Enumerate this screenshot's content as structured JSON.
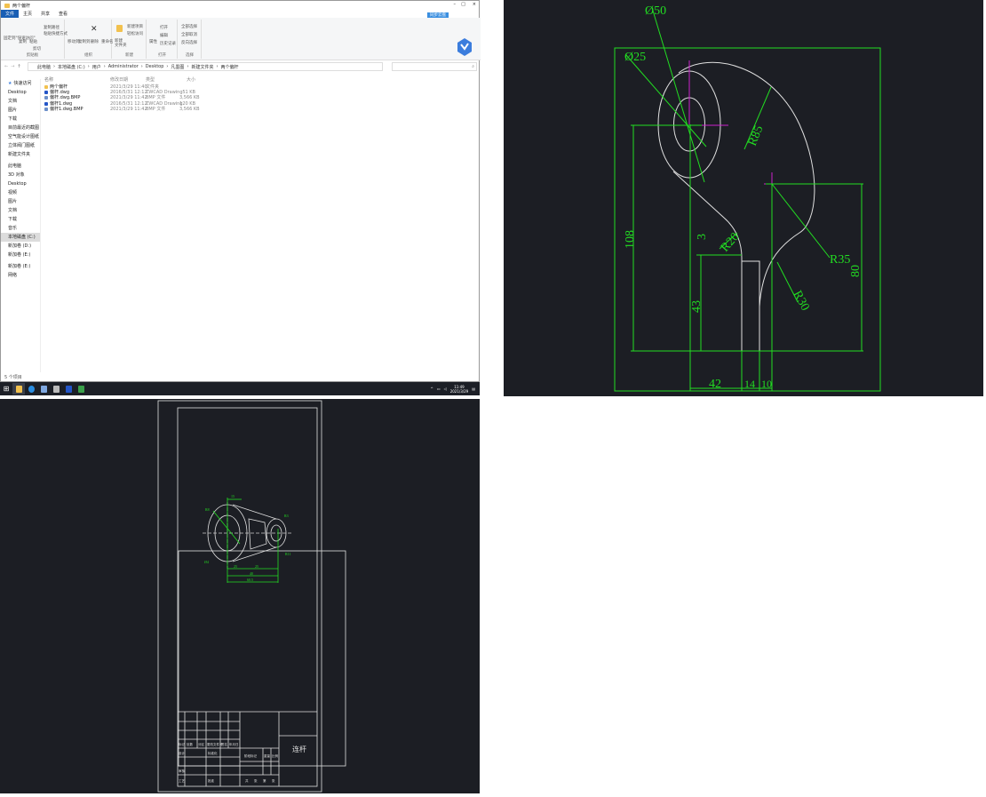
{
  "explorer": {
    "title": "两个偏杆",
    "window_controls": {
      "minimize": "–",
      "maximize": "□",
      "close": "×"
    },
    "menu_tabs": [
      "文件",
      "主页",
      "共享",
      "查看"
    ],
    "cloud_button": "同步云盘",
    "ribbon": {
      "groups": [
        "剪贴板",
        "组织",
        "新建",
        "打开",
        "选择"
      ],
      "pin": "固定到\"快速访问\"",
      "copy": "复制",
      "paste": "粘贴",
      "copy_path": "复制路径",
      "paste_shortcut": "粘贴快捷方式",
      "cut": "剪切",
      "move_to": "移动到",
      "copy_to": "复制到",
      "delete": "删除",
      "rename": "重命名",
      "new_folder": "新建\n文件夹",
      "new_item": "新建项目",
      "easy_access": "轻松访问",
      "properties": "属性",
      "open": "打开",
      "edit": "编辑",
      "history": "历史记录",
      "select_all": "全部选择",
      "select_none": "全部取消",
      "invert": "反向选择"
    },
    "breadcrumb": [
      "此电脑",
      "本地磁盘 (C:)",
      "用户",
      "Administrator",
      "Desktop",
      "凡墨图",
      "新建文件夹",
      "两个偏杆"
    ],
    "search_placeholder": "",
    "nav": {
      "quick_access": "快速访问",
      "quick_items": [
        "Desktop",
        "文档",
        "图片",
        "下载",
        "目前最近的截图",
        "空气能设计图纸",
        "立体阀门图纸",
        "新建文件夹"
      ],
      "this_pc": "此电脑",
      "pc_items": [
        "3D 对象",
        "Desktop",
        "视频",
        "图片",
        "文档",
        "下载",
        "音乐",
        "本地磁盘 (C:)",
        "新加卷 (D:)",
        "新加卷 (E:)"
      ],
      "extra": "新加卷 (E:)",
      "network": "网络"
    },
    "columns": [
      "名称",
      "修改日期",
      "类型",
      "大小"
    ],
    "files": [
      {
        "name": "两个偏杆",
        "date": "2021/3/29 11:40",
        "type": "文件夹",
        "size": "",
        "icon": "folder"
      },
      {
        "name": "偏杆.dwg",
        "date": "2016/5/31 12:12",
        "type": "ZWCAD Drawing",
        "size": "51 KB",
        "icon": "dwg"
      },
      {
        "name": "偏杆.dwg.BMP",
        "date": "2021/3/29 11:42",
        "type": "BMP 文件",
        "size": "3,566 KB",
        "icon": "bmp"
      },
      {
        "name": "偏杆1.dwg",
        "date": "2016/5/31 12:12",
        "type": "ZWCAD Drawing",
        "size": "120 KB",
        "icon": "dwg"
      },
      {
        "name": "偏杆1.dwg.BMP",
        "date": "2021/3/29 11:42",
        "type": "BMP 文件",
        "size": "3,566 KB",
        "icon": "bmp"
      }
    ],
    "status": "5 个项目"
  },
  "taskbar": {
    "time": "11:49",
    "date": "2021/3/29"
  },
  "cad_top": {
    "dims": {
      "d50": "Ø50",
      "d25": "Ø25",
      "r85": "R85",
      "r20": "R20",
      "r35": "R35",
      "r30": "R30",
      "h108": "108",
      "h80": "80",
      "h43": "43",
      "h3": "3",
      "w42": "42",
      "w14": "14",
      "w10": "10"
    },
    "colors": {
      "bg": "#1c1e24",
      "dim": "#22dd22",
      "geometry": "#e0e0e0",
      "center": "#cc22cc"
    }
  },
  "cad_bottom": {
    "dims": {
      "a": "R3",
      "b": "R8",
      "c": "Ø4",
      "d": "R11",
      "e": "25",
      "f": "25",
      "g": "40",
      "h": "60.5",
      "i": "15"
    },
    "title_block": {
      "part_name": "连杆",
      "row_headers": [
        "标记",
        "处数",
        "分区",
        "更改文件号",
        "签名",
        "年月日"
      ],
      "design": "设计",
      "standardize": "标准化",
      "review": "审核",
      "process": "工艺",
      "approve": "批准",
      "stage": "阶段标记",
      "weight": "重量",
      "scale": "比例",
      "sheets": [
        "共",
        "张",
        "第",
        "张"
      ]
    }
  }
}
